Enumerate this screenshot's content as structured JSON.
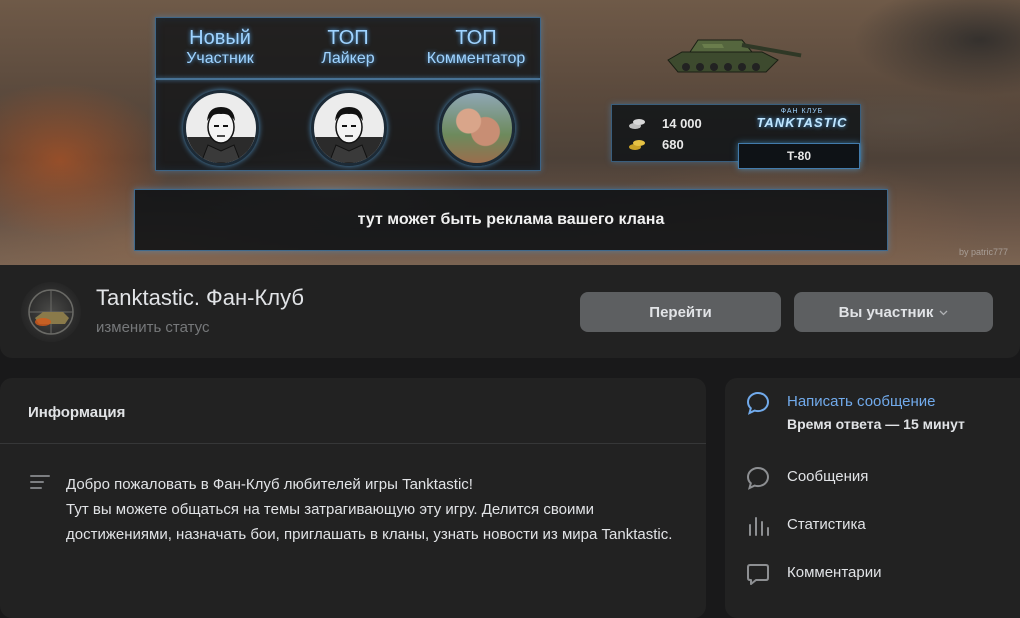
{
  "cover": {
    "badges": [
      {
        "title": "Новый",
        "subtitle": "Участник"
      },
      {
        "title": "ТОП",
        "subtitle": "Лайкер"
      },
      {
        "title": "ТОП",
        "subtitle": "Комментатор"
      }
    ],
    "stats": {
      "silver": "14 000",
      "gold": "680"
    },
    "logo": {
      "small": "ФАН КЛУБ",
      "big": "TANKTASTIC"
    },
    "tank_name": "T-80",
    "ad_text": "тут может быть реклама вашего клана",
    "watermark": "by patric777"
  },
  "header": {
    "group_name": "Tanktastic. Фан-Клуб",
    "status": "изменить статус",
    "go_button": "Перейти",
    "member_button": "Вы участник"
  },
  "info": {
    "title": "Информация",
    "description_lines": [
      "Добро пожаловать в Фан-Клуб любителей игры Tanktastic!",
      "Тут вы можете общаться на темы затрагивающую эту игру. Делится своими достижениями, назначать бои, приглашать в кланы, узнать новости из мира Tanktastic."
    ]
  },
  "side": {
    "write_message": "Написать сообщение",
    "response_time": "Время ответа — 15 минут",
    "messages": "Сообщения",
    "statistics": "Статистика",
    "comments": "Комментарии"
  },
  "colors": {
    "accent": "#71aaeb",
    "card_bg": "#222222",
    "button_bg": "#5d5f61",
    "page_bg": "#19191a"
  },
  "icons": [
    "message-icon",
    "chat-icon",
    "statistics-icon",
    "comments-icon",
    "description-icon",
    "chevron-down-icon",
    "tank-icon",
    "silver-coins-icon",
    "gold-coins-icon"
  ]
}
